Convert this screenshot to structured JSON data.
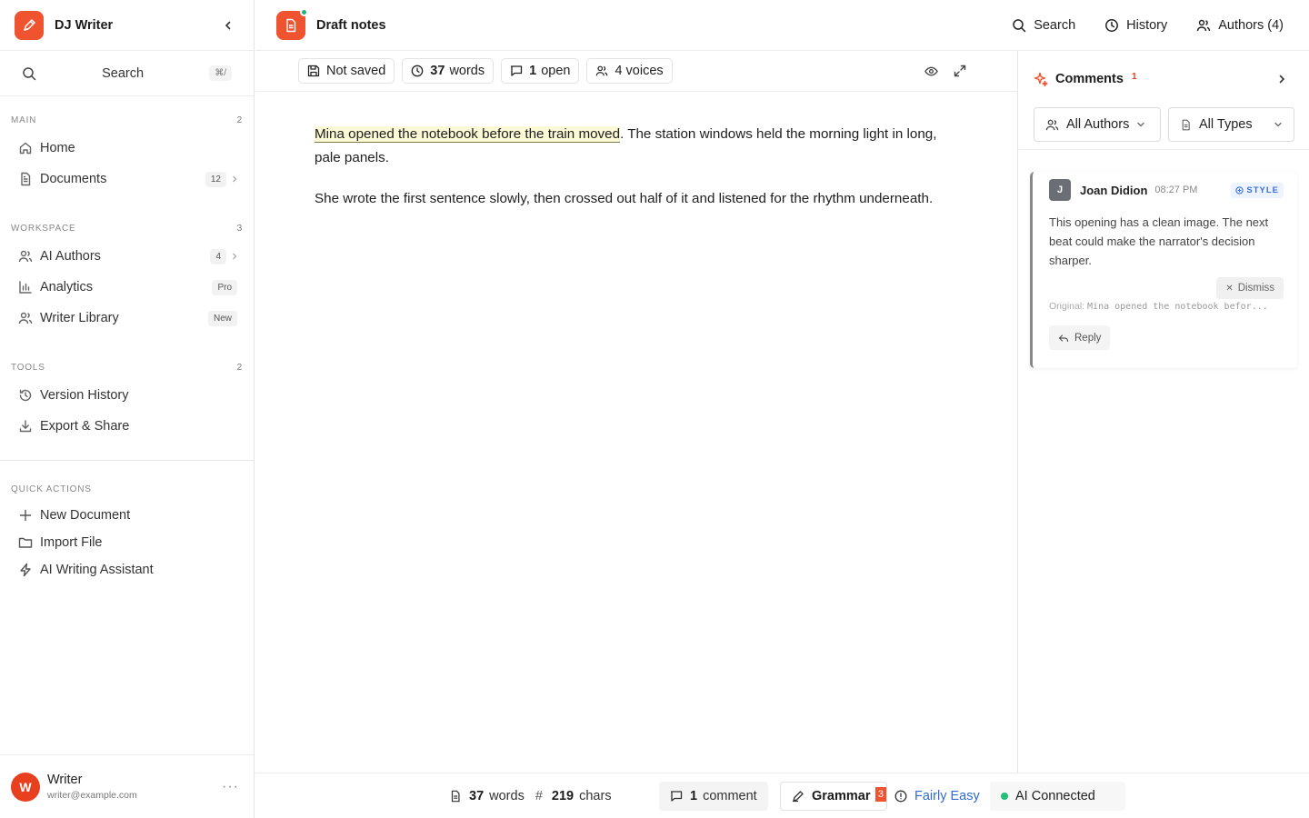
{
  "app": {
    "title": "DJ Writer"
  },
  "sidebar": {
    "search": {
      "label": "Search",
      "shortcut": "⌘/"
    },
    "main": {
      "title": "MAIN",
      "count": "2",
      "items": [
        {
          "label": "Home",
          "icon": "home-icon"
        },
        {
          "label": "Documents",
          "icon": "document-icon",
          "badge": "12"
        }
      ]
    },
    "workspace": {
      "title": "WORKSPACE",
      "count": "3",
      "items": [
        {
          "label": "AI Authors",
          "icon": "users-icon",
          "badge": "4"
        },
        {
          "label": "Analytics",
          "icon": "bar-chart-icon",
          "badge": "Pro"
        },
        {
          "label": "Writer Library",
          "icon": "users-icon",
          "badge": "New"
        }
      ]
    },
    "tools": {
      "title": "TOOLS",
      "count": "2",
      "items": [
        {
          "label": "Version History",
          "icon": "history-icon"
        },
        {
          "label": "Export & Share",
          "icon": "download-icon"
        }
      ]
    },
    "quick_actions": {
      "title": "QUICK ACTIONS",
      "items": [
        {
          "label": "New Document",
          "icon": "plus-icon"
        },
        {
          "label": "Import File",
          "icon": "folder-icon"
        },
        {
          "label": "AI Writing Assistant",
          "icon": "lightning-icon"
        }
      ]
    },
    "user": {
      "initial": "W",
      "name": "Writer",
      "email": "writer@example.com",
      "more": "···"
    }
  },
  "header": {
    "doc_title": "Draft notes",
    "actions": {
      "search": "Search",
      "history": "History",
      "authors": "Authors (4)"
    }
  },
  "toolbar": {
    "save_status": "Not saved",
    "words_count": "37",
    "words_label": "words",
    "open_count": "1",
    "open_label": "open",
    "voices": "4 voices"
  },
  "document": {
    "p1_highlight": "Mina opened the notebook before the train moved",
    "p1_rest": ". The station windows held the morning light in long, pale panels.",
    "p2": "She wrote the first sentence slowly, then crossed out half of it and listened for the rhythm underneath."
  },
  "status": {
    "words_count": "37",
    "words_label": "words",
    "chars_count": "219",
    "chars_label": "chars",
    "comment_count": "1",
    "comment_label": "comment",
    "grammar_label": "Grammar",
    "grammar_badge": "3",
    "readability": "Fairly Easy",
    "ai_status": "AI Connected"
  },
  "comments_panel": {
    "title": "Comments",
    "count": "1",
    "filters": {
      "authors": "All Authors",
      "types": "All Types"
    },
    "comments": [
      {
        "initial": "J",
        "author": "Joan Didion",
        "time": "08:27 PM",
        "tag": "STYLE",
        "body": "This opening has a clean image. The next beat could make the narrator's decision sharper.",
        "dismiss": "Dismiss",
        "original_label": "Original:",
        "original_text": "Mina opened the notebook befor...",
        "reply": "Reply"
      }
    ]
  },
  "colors": {
    "accent": "#f0532f",
    "online": "#22b573",
    "link": "#2f6bd1",
    "tag": "#3a6fd8"
  }
}
